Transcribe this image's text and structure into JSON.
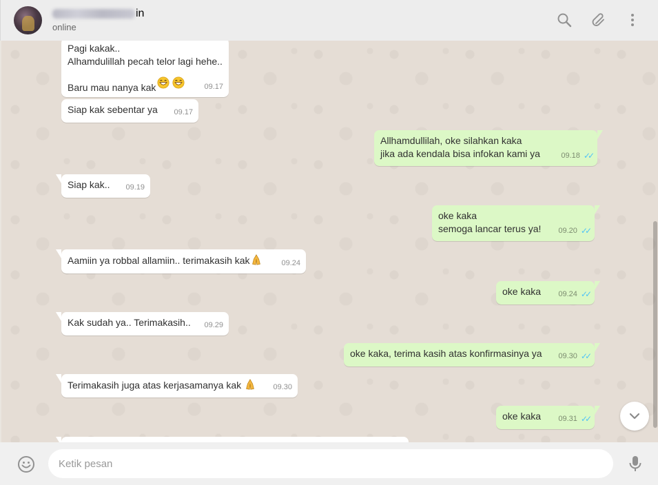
{
  "header": {
    "contact_name_visible": "in",
    "status": "online",
    "icons": [
      "search-icon",
      "attach-icon",
      "menu-icon"
    ]
  },
  "messages": [
    {
      "dir": "in",
      "text": "Pagi kakak..\nAlhamdulillah pecah telor lagi hehe..\n\nBaru mau nanya kak",
      "emoji": "grin-grin",
      "time": "09.17"
    },
    {
      "dir": "in",
      "text": "Siap kak sebentar ya",
      "time": "09.17"
    },
    {
      "dir": "out",
      "text": "Allhamdullilah, oke silahkan kaka\njika ada kendala bisa infokan kami ya",
      "time": "09.18",
      "read": true
    },
    {
      "dir": "in",
      "text": "Siap kak..",
      "time": "09.19"
    },
    {
      "dir": "out",
      "text": "oke kaka\nsemoga lancar terus ya!",
      "time": "09.20",
      "read": true
    },
    {
      "dir": "in",
      "text": "Aamiin ya robbal allamiin.. terimakasih kak",
      "emoji": "pray",
      "time": "09.24"
    },
    {
      "dir": "out",
      "text": "oke kaka",
      "time": "09.24",
      "read": true
    },
    {
      "dir": "in",
      "text": "Kak sudah ya.. Terimakasih..",
      "time": "09.29"
    },
    {
      "dir": "out",
      "text": "oke kaka, terima kasih atas konfirmasinya ya",
      "time": "09.30",
      "read": true
    },
    {
      "dir": "in",
      "text": "Terimakasih juga atas kerjasamanya kak ",
      "emoji": "pray",
      "time": "09.30"
    },
    {
      "dir": "out",
      "text": "oke kaka",
      "time": "09.31",
      "read": true
    }
  ],
  "composer": {
    "placeholder": "Ketik pesan",
    "value": ""
  },
  "colors": {
    "incoming": "#ffffff",
    "outgoing": "#dcf8c6",
    "read_ticks": "#4fc3f7",
    "header_bg": "#ededed",
    "chat_bg": "#e5ddd5"
  }
}
